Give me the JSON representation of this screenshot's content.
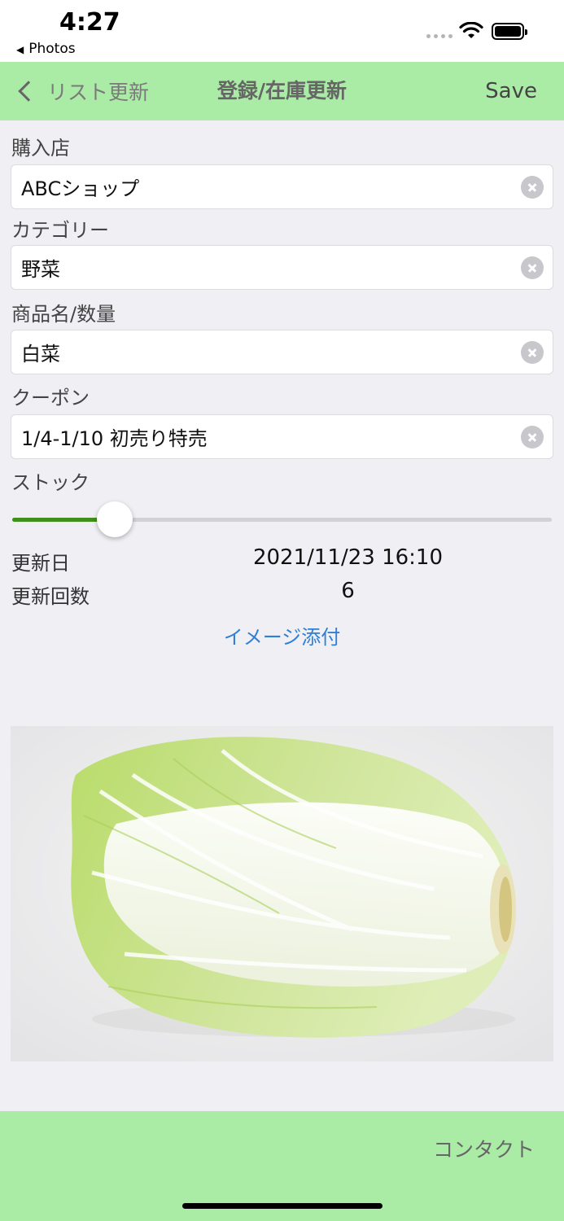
{
  "status_bar": {
    "time": "4:27",
    "back_app": "Photos",
    "back_glyph": "◀"
  },
  "nav": {
    "back_label": "リスト更新",
    "title": "登録/在庫更新",
    "save": "Save"
  },
  "form": {
    "store": {
      "label": "購入店",
      "value": "ABCショップ"
    },
    "category": {
      "label": "カテゴリー",
      "value": "野菜"
    },
    "product": {
      "label": "商品名/数量",
      "value": "白菜"
    },
    "coupon": {
      "label": "クーポン",
      "value": "1/4-1/10 初売り特売"
    },
    "stock": {
      "label": "ストック",
      "level": 0.19
    }
  },
  "info": {
    "updated_label": "更新日",
    "updated_value": "2021/11/23 16:10",
    "count_label": "更新回数",
    "count_value": "6"
  },
  "attach_image": "イメージ添付",
  "photo": {
    "subject": "napa-cabbage-photo"
  },
  "footer": {
    "contact": "コンタクト"
  },
  "colors": {
    "bar_green": "#aaeba6",
    "slider_fill": "#3f8f1a",
    "link_blue": "#2d7fd8"
  }
}
